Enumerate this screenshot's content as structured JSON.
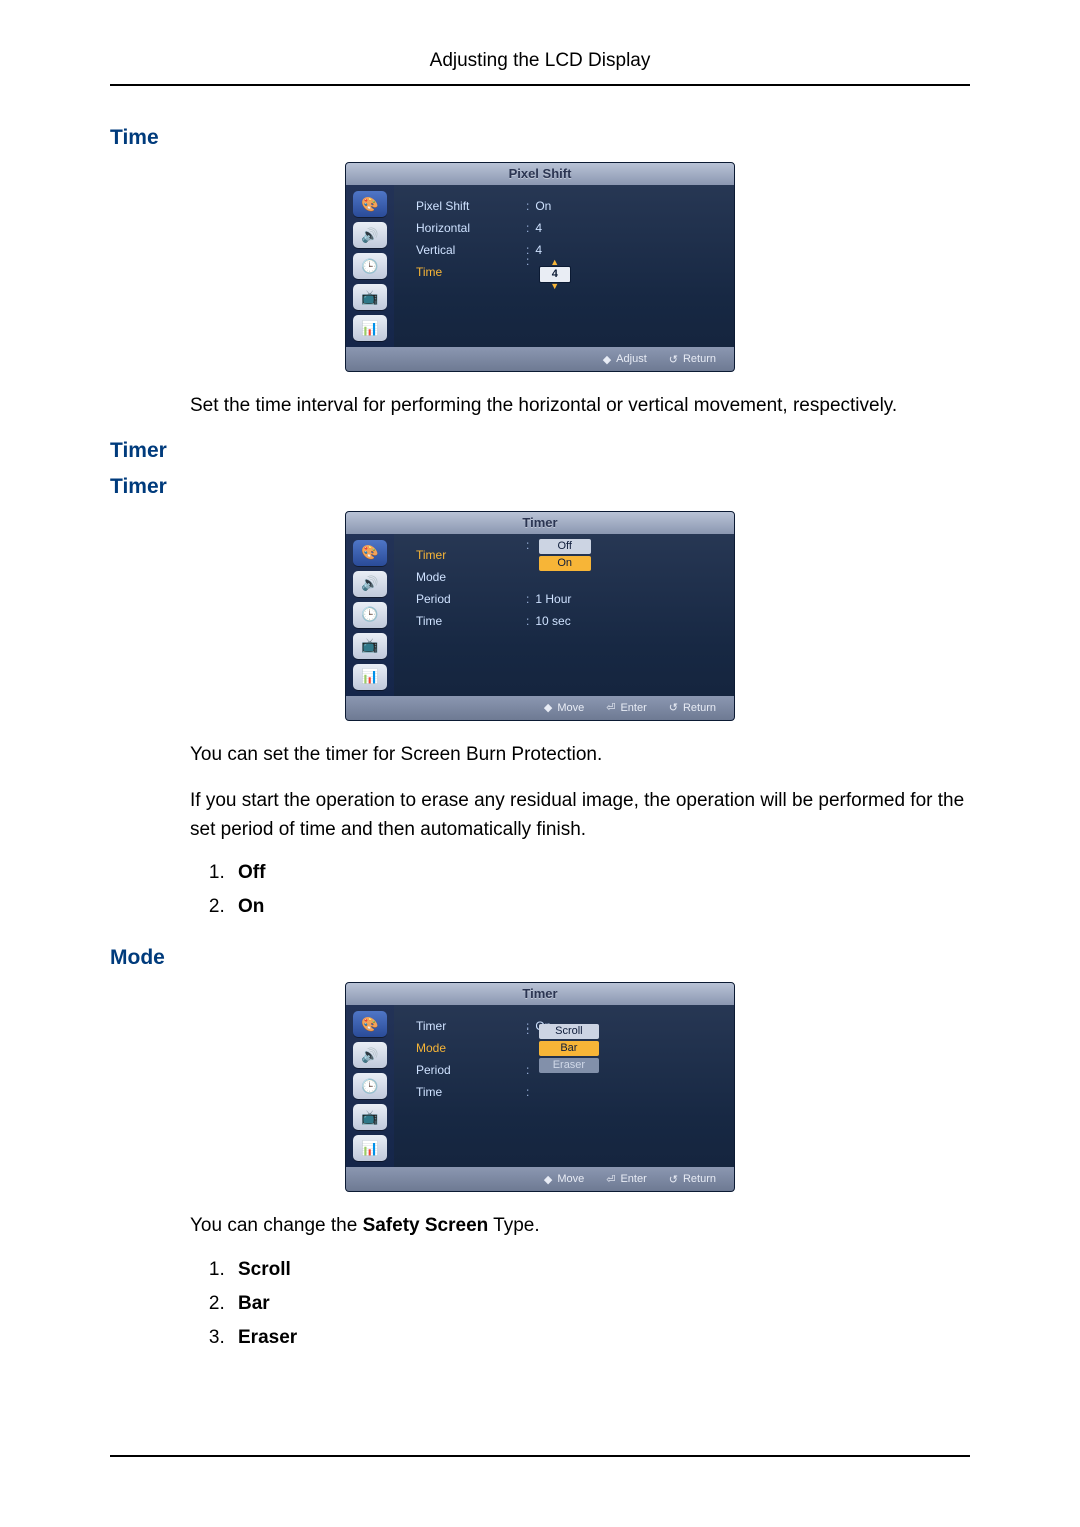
{
  "header": {
    "title": "Adjusting the LCD Display"
  },
  "sections": {
    "time": {
      "heading": "Time",
      "osd": {
        "title": "Pixel Shift",
        "rows": {
          "r1": {
            "label": "Pixel Shift",
            "value": "On"
          },
          "r2": {
            "label": "Horizontal",
            "value": "4"
          },
          "r3": {
            "label": "Vertical",
            "value": "4"
          },
          "r4": {
            "label": "Time",
            "value": "4"
          }
        },
        "footer": {
          "a": "Adjust",
          "b": "Return"
        }
      },
      "desc": "Set the time interval for performing the horizontal or vertical movement, respectively."
    },
    "timer1": {
      "heading": "Timer"
    },
    "timer2": {
      "heading": "Timer",
      "osd": {
        "title": "Timer",
        "rows": {
          "r1": {
            "label": "Timer",
            "opt_off": "Off",
            "opt_on": "On"
          },
          "r2": {
            "label": "Mode"
          },
          "r3": {
            "label": "Period",
            "value": "1 Hour"
          },
          "r4": {
            "label": "Time",
            "value": "10 sec"
          }
        },
        "footer": {
          "a": "Move",
          "b": "Enter",
          "c": "Return"
        }
      },
      "desc1": "You can set the timer for Screen Burn Protection.",
      "desc2": "If you start the operation to erase any residual image, the operation will be performed for the set period of time and then automatically finish.",
      "list": {
        "i1": "Off",
        "i2": "On"
      }
    },
    "mode": {
      "heading": "Mode",
      "osd": {
        "title": "Timer",
        "rows": {
          "r1": {
            "label": "Timer",
            "value": "On"
          },
          "r2": {
            "label": "Mode",
            "opt_scroll": "Scroll",
            "opt_bar": "Bar",
            "opt_eraser": "Eraser"
          },
          "r3": {
            "label": "Period"
          },
          "r4": {
            "label": "Time"
          }
        },
        "footer": {
          "a": "Move",
          "b": "Enter",
          "c": "Return"
        }
      },
      "desc_pre": "You can change the ",
      "desc_bold": "Safety Screen",
      "desc_post": " Type.",
      "list": {
        "i1": "Scroll",
        "i2": "Bar",
        "i3": "Eraser"
      }
    }
  }
}
